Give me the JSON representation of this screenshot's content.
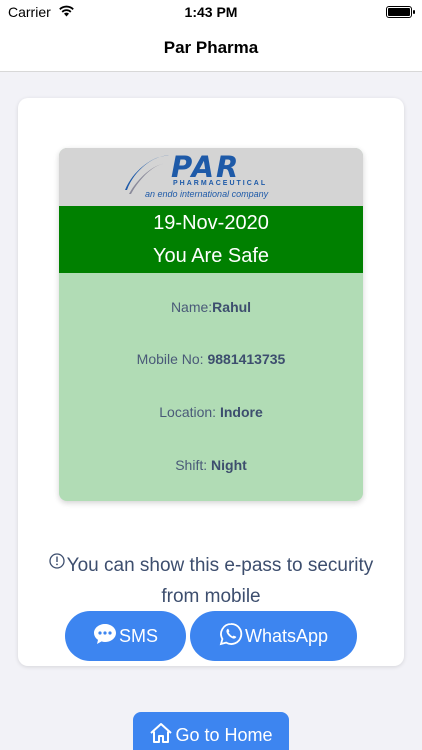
{
  "status_bar": {
    "carrier": "Carrier",
    "time": "1:43 PM"
  },
  "nav": {
    "title": "Par Pharma"
  },
  "pass": {
    "logo": {
      "brand": "PAR",
      "sub": "PHARMACEUTICAL",
      "tagline": "an endo international company"
    },
    "date": "19-Nov-2020",
    "status": "You Are Safe",
    "status_color": "#008000",
    "body_color": "#b1dcb5",
    "name_label": "Name:",
    "name_value": "Rahul",
    "mobile_label": "Mobile No: ",
    "mobile_value": "9881413735",
    "location_label": "Location: ",
    "location_value": "Indore",
    "shift_label": "Shift: ",
    "shift_value": "Night"
  },
  "info": {
    "icon": "info-circle-icon",
    "text": "You can show this e-pass to security from mobile"
  },
  "actions": {
    "sms_label": "SMS",
    "sms_icon": "chat-bubble-icon",
    "whatsapp_label": "WhatsApp",
    "whatsapp_icon": "whatsapp-icon",
    "home_label": "Go to Home",
    "home_icon": "home-icon",
    "accent": "#3d85f0"
  }
}
